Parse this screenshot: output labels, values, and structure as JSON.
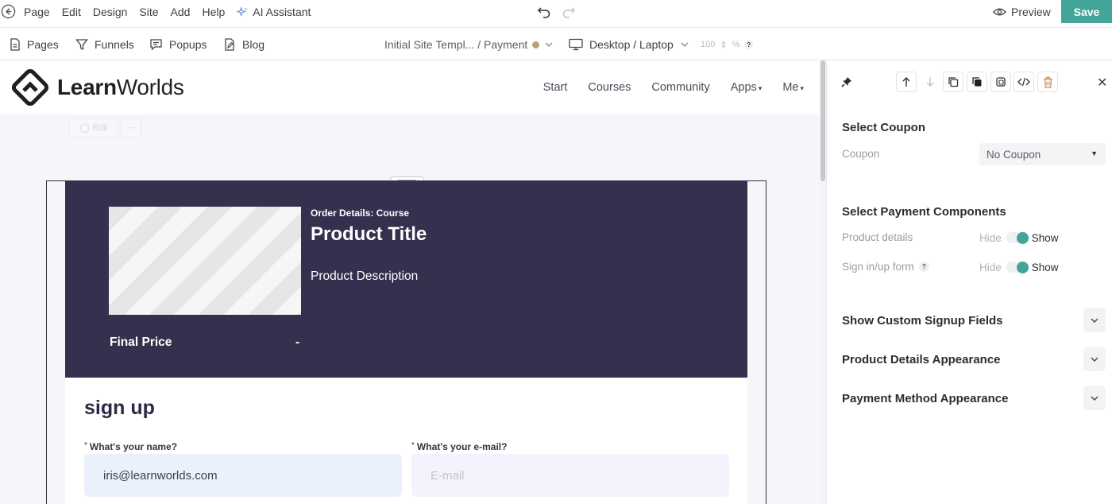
{
  "topbar": {
    "menu": [
      "Page",
      "Edit",
      "Design",
      "Site",
      "Add",
      "Help"
    ],
    "ai_assistant": "AI Assistant",
    "preview": "Preview",
    "save": "Save"
  },
  "toolbar": {
    "pages": "Pages",
    "funnels": "Funnels",
    "popups": "Popups",
    "blog": "Blog",
    "breadcrumb": "Initial Site Templ... / Payment",
    "breadcrumb_status_color": "#b9a27a",
    "device": "Desktop / Laptop",
    "zoom_value": "100",
    "zoom_unit": "%"
  },
  "site": {
    "logo_bold": "Learn",
    "logo_rest": "Worlds",
    "nav": [
      "Start",
      "Courses",
      "Community",
      "Apps",
      "Me"
    ],
    "edit_ghost": "Edit",
    "more_ghost": "⋯"
  },
  "product": {
    "order_label": "Order Details: Course",
    "title": "Product Title",
    "description": "Product Description",
    "final_price_label": "Final Price",
    "final_price_value": "-"
  },
  "signup": {
    "title": "sign up",
    "name_label": "What's your name?",
    "name_value": "iris@learnworlds.com",
    "email_label": "What's your e-mail?",
    "email_placeholder": "E-mail"
  },
  "panel": {
    "select_coupon": "Select Coupon",
    "coupon_label": "Coupon",
    "coupon_value": "No Coupon",
    "select_components": "Select Payment Components",
    "product_details_label": "Product details",
    "signin_form_label": "Sign in/up form",
    "hide": "Hide",
    "show": "Show",
    "accordions": [
      "Show Custom Signup Fields",
      "Product Details Appearance",
      "Payment Method Appearance"
    ]
  },
  "colors": {
    "accent": "#43a59a",
    "product_panel": "#34314f"
  }
}
